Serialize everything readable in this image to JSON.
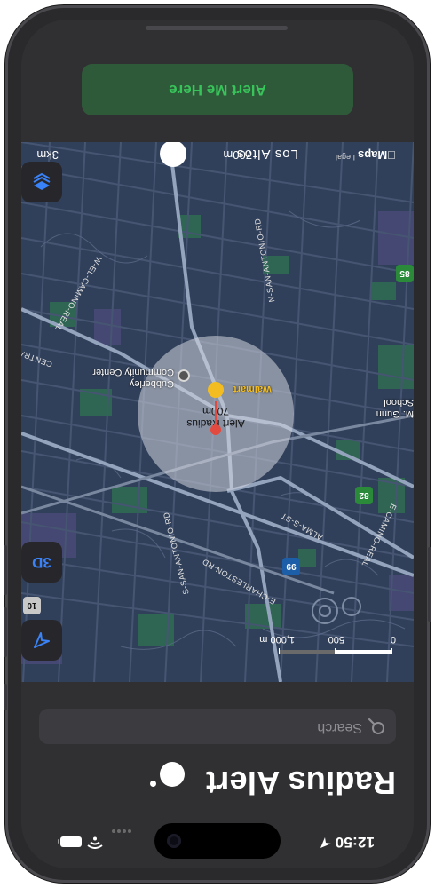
{
  "status_bar": {
    "time": "12:50",
    "location_icon": "location-arrow-icon",
    "wifi_icon": "wifi-icon",
    "battery_icon": "battery-icon"
  },
  "header": {
    "title": "Radius Alert"
  },
  "search": {
    "placeholder": "Search"
  },
  "map": {
    "controls": {
      "layers_icon": "layers-icon",
      "threeD_label": "3D",
      "location_icon": "location-arrow-icon"
    },
    "radius_overlay": {
      "title": "Alert Radius",
      "radius_text": "700m"
    },
    "pois": {
      "walmart": "Walmart",
      "cubberley_line1": "Cubberley",
      "cubberley_line2": "Community Center",
      "school_line1": "M. Gunn",
      "school_line2": "School"
    },
    "roads": {
      "el_camino_real_1": "W-EL-CAMINO-REAL",
      "el_camino_real_2": "E-CAMINO-REAL",
      "san_antonio_rd_1": "N-SAN-ANTONIO-RD",
      "san_antonio_rd_2": "S-SAN-ANTONIO-RD",
      "alma_st": "ALMA-S-ST",
      "charleston_rd": "E-CHARLESTON-RD",
      "central": "CENTRAL"
    },
    "shields": [
      "82",
      "85",
      "99",
      "10"
    ],
    "scale": {
      "labels": [
        "0",
        "500",
        "1,000 m"
      ]
    },
    "attribution": "Maps",
    "legal": "Legal",
    "city": "Los Altos",
    "radius_readout": "700m",
    "slider_max": "3km"
  },
  "alert_button": {
    "label": "Alert Me Here"
  },
  "colors": {
    "accent_blue": "#3a82f7",
    "alert_green": "#38c45a",
    "alert_bg": "#2f5a3a",
    "pin_red": "#e34a3f",
    "walmart_yellow": "#f3bd22",
    "map_bg": "#31405a"
  }
}
